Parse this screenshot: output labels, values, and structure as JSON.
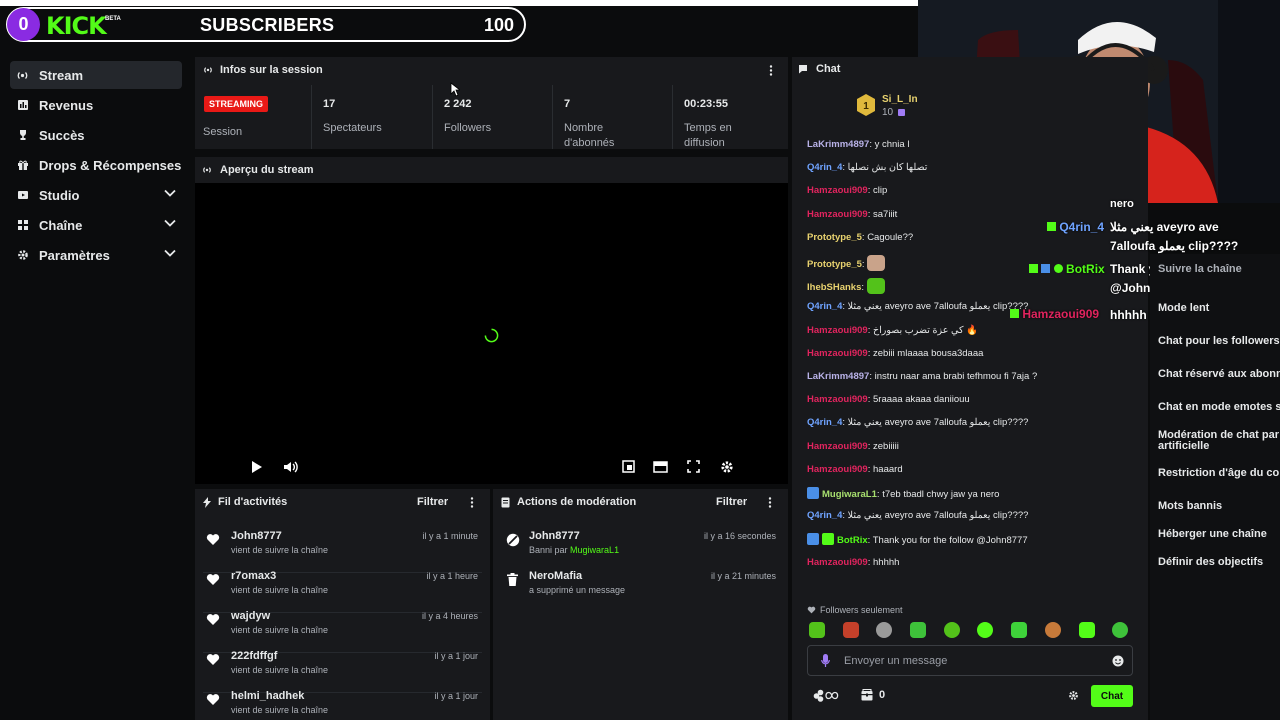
{
  "overlay": {
    "sub_count": "0",
    "brand": "KICK",
    "beta": "BETA",
    "title": "SUBSCRIBERS",
    "goal": "100"
  },
  "sidebar": {
    "items": [
      {
        "label": "Stream",
        "icon": "broadcast-icon"
      },
      {
        "label": "Revenus",
        "icon": "revenue-icon"
      },
      {
        "label": "Succès",
        "icon": "trophy-icon"
      },
      {
        "label": "Drops & Récompenses",
        "icon": "gift-icon"
      },
      {
        "label": "Studio",
        "icon": "studio-icon"
      },
      {
        "label": "Chaîne",
        "icon": "channel-icon"
      },
      {
        "label": "Paramètres",
        "icon": "gear-icon"
      }
    ]
  },
  "session": {
    "title": "Infos sur la session",
    "badge": "STREAMING",
    "badge_label": "Session",
    "stats": [
      {
        "value": "17",
        "label": "Spectateurs"
      },
      {
        "value": "2 242",
        "label": "Followers"
      },
      {
        "value": "7",
        "label": "Nombre d'abonnés"
      },
      {
        "value": "00:23:55",
        "label": "Temps en diffusion"
      }
    ]
  },
  "preview": {
    "title": "Aperçu du stream"
  },
  "activity": {
    "title": "Fil d'activités",
    "filter": "Filtrer",
    "items": [
      {
        "name": "John8777",
        "sub": "vient de suivre la chaîne",
        "time": "il y a 1 minute"
      },
      {
        "name": "r7omax3",
        "sub": "vient de suivre la chaîne",
        "time": "il y a 1 heure"
      },
      {
        "name": "wajdyw",
        "sub": "vient de suivre la chaîne",
        "time": "il y a 4 heures"
      },
      {
        "name": "222fdffgf",
        "sub": "vient de suivre la chaîne",
        "time": "il y a 1 jour"
      },
      {
        "name": "helmi_hadhek",
        "sub": "vient de suivre la chaîne",
        "time": "il y a 1 jour"
      }
    ]
  },
  "moderation": {
    "title": "Actions de modération",
    "filter": "Filtrer",
    "items": [
      {
        "name": "John8777",
        "sub_prefix": "Banni par",
        "sub_user": "MugiwaraL1",
        "time": "il y a 16 secondes"
      },
      {
        "name": "NeroMafia",
        "sub_prefix": "a supprimé un message",
        "sub_user": "",
        "time": "il y a 21 minutes"
      }
    ]
  },
  "chat": {
    "title": "Chat",
    "pinned": {
      "name": "Si_L_In",
      "count": "10",
      "rank": "1"
    },
    "messages": [
      {
        "user": "LaKrimm4897",
        "color": "#b9b2e8",
        "text": "y chnia l"
      },
      {
        "user": "Q4rin_4",
        "color": "#6fa3ff",
        "text": "تصلها كان بش نصلها"
      },
      {
        "user": "Hamzaoui909",
        "color": "#e0245e",
        "text": "clip"
      },
      {
        "user": "Hamzaoui909",
        "color": "#e0245e",
        "text": "sa7iiit"
      },
      {
        "user": "Prototype_5",
        "color": "#e8d26f",
        "text": "Cagoule??"
      },
      {
        "user": "Prototype_5",
        "color": "#e8d26f",
        "text": ""
      },
      {
        "user": "IhebSHanks",
        "color": "#e8d26f",
        "text": ""
      },
      {
        "user": "Q4rin_4",
        "color": "#6fa3ff",
        "text": "يعني مثلا aveyro ave 7alloufa يعملو clip????"
      },
      {
        "user": "Hamzaoui909",
        "color": "#e0245e",
        "text": "كي عزة تضرب بصوراخ 🔥"
      },
      {
        "user": "Hamzaoui909",
        "color": "#e0245e",
        "text": "zebiii mlaaaa bousa3daaa"
      },
      {
        "user": "LaKrimm4897",
        "color": "#b9b2e8",
        "text": "instru naar ama brabi tefhmou fi 7aja ?"
      },
      {
        "user": "Hamzaoui909",
        "color": "#e0245e",
        "text": "5raaaa akaaa daniiouu"
      },
      {
        "user": "Q4rin_4",
        "color": "#6fa3ff",
        "text": "يعني مثلا aveyro ave 7alloufa يعملو clip????"
      },
      {
        "user": "Hamzaoui909",
        "color": "#e0245e",
        "text": "zebiiiii"
      },
      {
        "user": "Hamzaoui909",
        "color": "#e0245e",
        "text": "haaard"
      },
      {
        "user": "MugiwaraL1",
        "color": "#a8e06f",
        "text": "t7eb tbadl chwy jaw ya nero"
      },
      {
        "user": "Q4rin_4",
        "color": "#6fa3ff",
        "text": "يعني مثلا aveyro ave 7alloufa يعملو clip????"
      },
      {
        "user": "BotRix",
        "color": "#53fc18",
        "text": "Thank you for the follow @John8777"
      },
      {
        "user": "Hamzaoui909",
        "color": "#e0245e",
        "text": "hhhhh"
      }
    ],
    "followers_only": "Followers seulement",
    "input_placeholder": "Envoyer un message",
    "points": "0",
    "send": "Chat"
  },
  "overlay_chat": {
    "line0": "nero",
    "q4rin_user": "Q4rin_4",
    "q4rin_text": "يعني مثلا aveyro ave",
    "q4rin_text2": "7alloufa يعملو clip????",
    "botrix_user": "BotRix",
    "botrix_text": "Thank you for the follow",
    "botrix_text2": "@John8777",
    "hamza_user": "Hamzaoui909",
    "hamza_text": "hhhhh"
  },
  "settings": {
    "items": [
      "Suivre la chaîne",
      "Mode lent",
      "Chat pour les followers",
      "Chat réservé aux abonn",
      "Chat en mode emotes s",
      "Modération de chat par artificielle",
      "Restriction d'âge du co",
      "Mots bannis",
      "Héberger une chaîne",
      "Définir des objectifs"
    ]
  }
}
